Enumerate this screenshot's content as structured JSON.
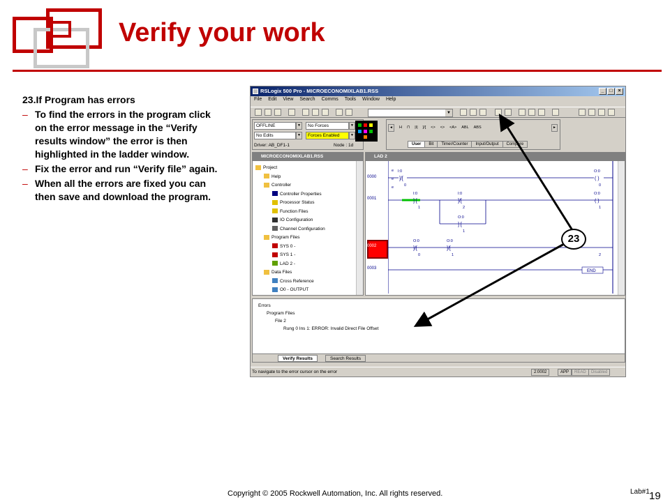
{
  "slide": {
    "title": "Verify your work",
    "notes_heading": "23.If Program has errors",
    "bullets": [
      "To find the errors in the program click on the error message in the “Verify results window” the error is then highlighted in the ladder window.",
      "Fix the error and run “Verify file” again.",
      "When all the errors are fixed you can then save and download the program."
    ],
    "footer": "Copyright © 2005 Rockwell Automation, Inc. All rights reserved.",
    "slide_ref": "Lab#1",
    "page_number": "19",
    "callout_number": "23"
  },
  "app": {
    "title": "RSLogix 500 Pro - MICROECONOMIXLAB1.RSS",
    "menu": [
      "File",
      "Edit",
      "View",
      "Search",
      "Comms",
      "Tools",
      "Window",
      "Help"
    ],
    "status": {
      "mode": "OFFLINE",
      "forces": "No Forces",
      "edits": "No Edits",
      "forces_enabled": "Forces Enabled",
      "driver": "Driver: AB_DF1-1",
      "node": "Node : 1d"
    },
    "instruction_tabs": [
      "User",
      "Bit",
      "Timer/Counter",
      "Input/Output",
      "Compare"
    ],
    "instruction_symbols": [
      "H",
      "⊓",
      "|I|",
      "]/[",
      "<>",
      "<>",
      "<A>",
      "ABL",
      "ABS"
    ],
    "project_window_title": "MICROECONOMIXLAB1.RSS",
    "project_tree": [
      "Project",
      "Help",
      "Controller",
      "Controller Properties",
      "Processor Status",
      "Function Files",
      "IO Configuration",
      "Channel Configuration",
      "Program Files",
      "SYS 0 -",
      "SYS 1 -",
      "LAD 2 -",
      "Data Files",
      "Cross Reference",
      "O0 - OUTPUT"
    ],
    "ladder_window_title": "LAD 2",
    "rungs": [
      "0000",
      "0001",
      "0002",
      "0003"
    ],
    "ladder_labels": {
      "i0": "I:0",
      "o0": "O:0",
      "b0": "0",
      "b1": "1",
      "b2": "2",
      "end": "END",
      "eee": [
        "e",
        "e",
        "e"
      ]
    },
    "results_tree": [
      "Errors",
      "Program Files",
      "File 2",
      "Rung 0 Ins 1: ERROR: Invalid Direct File Offset"
    ],
    "results_tabs": [
      "Verify Results",
      "Search Results"
    ],
    "status_message": "To navigate to the error cursor on the error",
    "status_panes": [
      "2:0002",
      "APP",
      "READ",
      "Disabled"
    ]
  },
  "colors": {
    "accent": "#c00000",
    "title_bar": "#0a246a",
    "error_highlight": "#ff0000",
    "forces_enabled": "#ffff00",
    "ladder_rail": "#00008b"
  }
}
